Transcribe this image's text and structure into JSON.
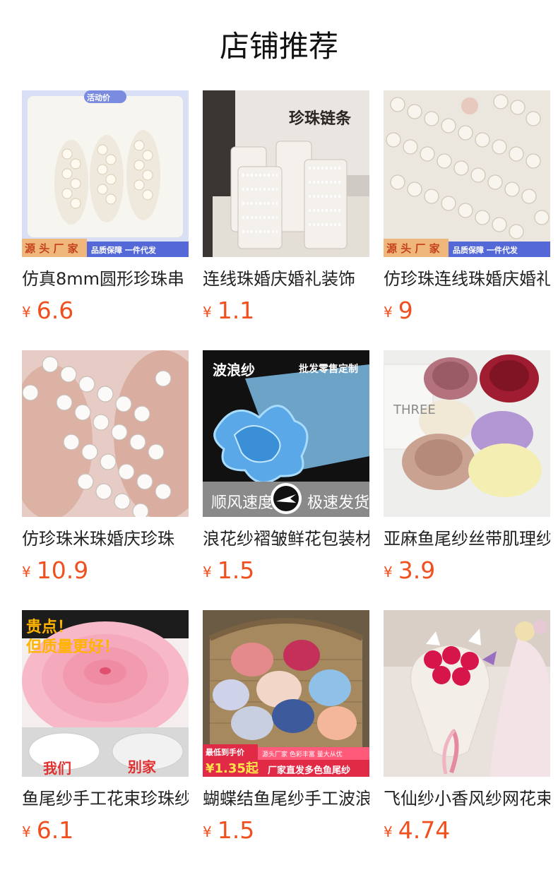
{
  "page": {
    "title": "店铺推荐"
  },
  "currency": "¥",
  "products": [
    {
      "name": "仿真8mm圆形珍珠串",
      "price": "6.6",
      "image": {
        "top_badge": "活动价",
        "bottom_left": "源 头 厂 家",
        "bottom_right": "品质保障  一件代发"
      }
    },
    {
      "name": "连线珠婚庆婚礼装饰",
      "price": "1.1",
      "image": {
        "title": "珍珠链条"
      }
    },
    {
      "name": "仿珍珠连线珠婚庆婚礼",
      "price": "9",
      "image": {
        "bottom_left": "源 头 厂 家",
        "bottom_right": "品质保障  一件代发"
      }
    },
    {
      "name": "仿珍珠米珠婚庆珍珠",
      "price": "10.9",
      "image": {}
    },
    {
      "name": "浪花纱褶皱鲜花包装材料",
      "price": "1.5",
      "image": {
        "title": "波浪纱",
        "title_right": "批发零售定制",
        "bottom_left": "顺风速度",
        "bottom_right": "极速发货"
      }
    },
    {
      "name": "亚麻鱼尾纱丝带肌理纱",
      "price": "3.9",
      "image": {
        "box_text": "THREE"
      }
    },
    {
      "name": "鱼尾纱手工花束珍珠纱",
      "price": "6.1",
      "image": {
        "line1": "贵点！",
        "line2": "但质量更好！",
        "bottom_left": "我们",
        "bottom_right": "别家"
      }
    },
    {
      "name": "蝴蝶结鱼尾纱手工波浪纱",
      "price": "1.5",
      "image": {
        "promo_label": "最低到手价",
        "promo_price": "¥1.35起",
        "promo_tags": "源头厂家  色彩丰富  量大从优",
        "promo_banner": "厂家直发多色鱼尾纱"
      }
    },
    {
      "name": "飞仙纱小香风纱网花束",
      "price": "4.74",
      "image": {}
    }
  ],
  "colors": {
    "price": "#f0501e",
    "title": "#111111",
    "name": "#222222"
  }
}
